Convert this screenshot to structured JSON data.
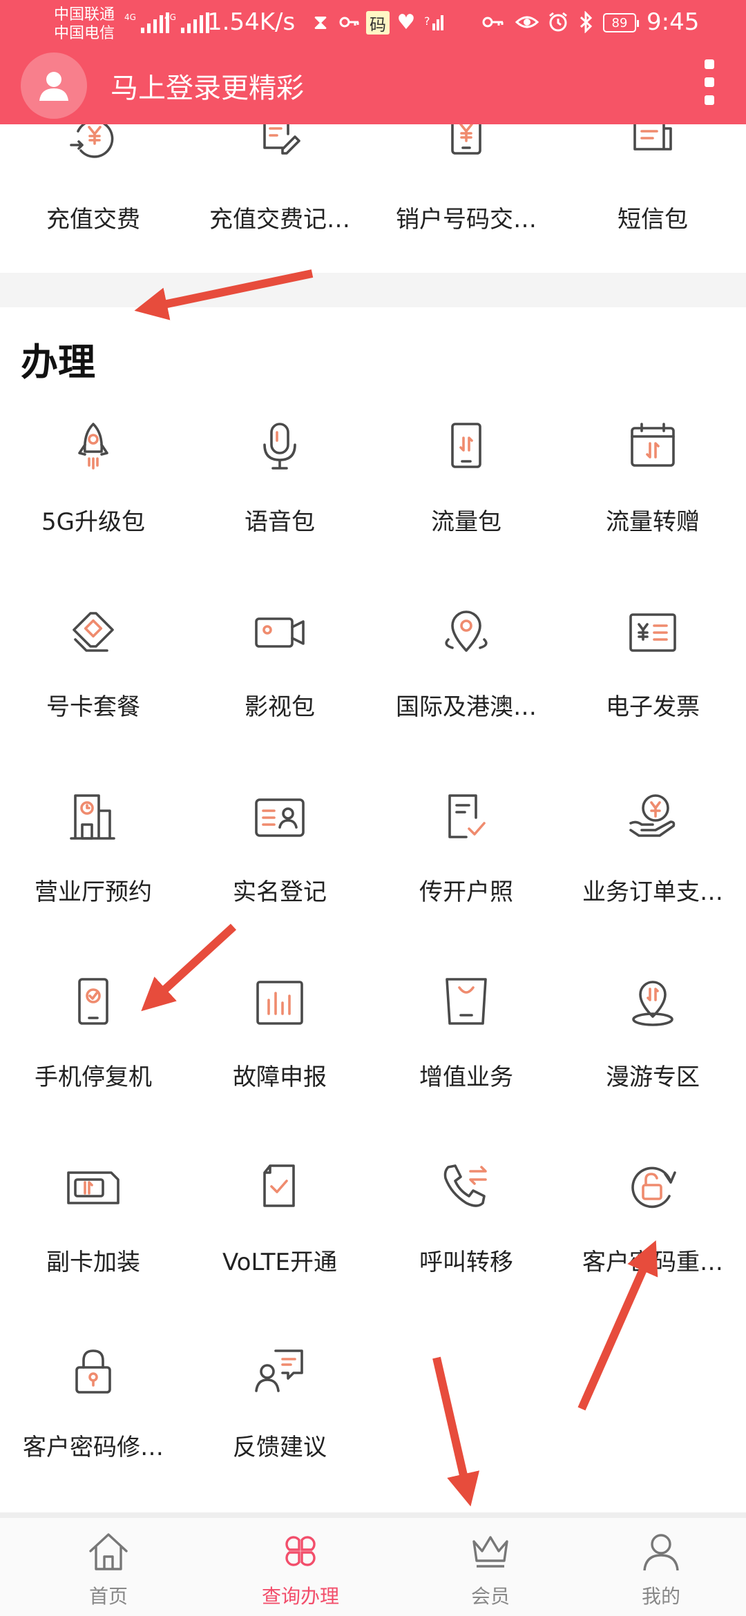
{
  "status_bar": {
    "carrier_1": "中国联通",
    "carrier_2": "中国电信",
    "network_1": "4G",
    "network_2": "4G",
    "speed": "1.54K/s",
    "ma_label": "码",
    "battery": "89",
    "time": "9:45",
    "icons": [
      "hourglass-icon",
      "key-icon",
      "heart-rate-icon",
      "signal-unknown-icon",
      "key-icon",
      "eye-icon",
      "alarm-icon",
      "bluetooth-icon"
    ]
  },
  "header": {
    "title": "马上登录更精彩",
    "avatar_icon": "user-icon",
    "menu_icon": "more-vertical-icon",
    "background": "#f65466"
  },
  "top_row": [
    {
      "label": "充值交费",
      "icon": "recharge-icon"
    },
    {
      "label": "充值交费记…",
      "icon": "recharge-record-icon"
    },
    {
      "label": "销户号码交…",
      "icon": "phone-yuan-icon"
    },
    {
      "label": "短信包",
      "icon": "sms-package-icon"
    }
  ],
  "section_title": "办理",
  "items": [
    {
      "label": "5G升级包",
      "icon": "rocket-icon"
    },
    {
      "label": "语音包",
      "icon": "microphone-icon"
    },
    {
      "label": "流量包",
      "icon": "phone-data-icon"
    },
    {
      "label": "流量转赠",
      "icon": "calendar-data-icon"
    },
    {
      "label": "号卡套餐",
      "icon": "sim-card-icon"
    },
    {
      "label": "影视包",
      "icon": "video-camera-icon"
    },
    {
      "label": "国际及港澳…",
      "icon": "location-pin-icon"
    },
    {
      "label": "电子发票",
      "icon": "invoice-icon"
    },
    {
      "label": "营业厅预约",
      "icon": "building-clock-icon"
    },
    {
      "label": "实名登记",
      "icon": "id-card-icon"
    },
    {
      "label": "传开户照",
      "icon": "document-check-icon"
    },
    {
      "label": "业务订单支…",
      "icon": "hand-yuan-icon"
    },
    {
      "label": "手机停复机",
      "icon": "phone-check-icon"
    },
    {
      "label": "故障申报",
      "icon": "bar-chart-icon"
    },
    {
      "label": "增值业务",
      "icon": "shopping-bag-icon"
    },
    {
      "label": "漫游专区",
      "icon": "roaming-pin-icon"
    },
    {
      "label": "副卡加装",
      "icon": "secondary-card-icon"
    },
    {
      "label": "VoLTE开通",
      "icon": "volte-document-icon"
    },
    {
      "label": "呼叫转移",
      "icon": "call-forward-icon"
    },
    {
      "label": "客户密码重…",
      "icon": "unlock-refresh-icon"
    },
    {
      "label": "客户密码修…",
      "icon": "lock-icon"
    },
    {
      "label": "反馈建议",
      "icon": "feedback-icon"
    }
  ],
  "tabs": [
    {
      "label": "首页",
      "icon": "home-icon",
      "active": false
    },
    {
      "label": "查询办理",
      "icon": "clover-icon",
      "active": true
    },
    {
      "label": "会员",
      "icon": "crown-icon",
      "active": false
    },
    {
      "label": "我的",
      "icon": "person-icon",
      "active": false
    }
  ],
  "colors": {
    "accent": "#f24e6b",
    "icon_orange": "#ef8b6e",
    "annotation_arrow": "#e74c3c"
  }
}
